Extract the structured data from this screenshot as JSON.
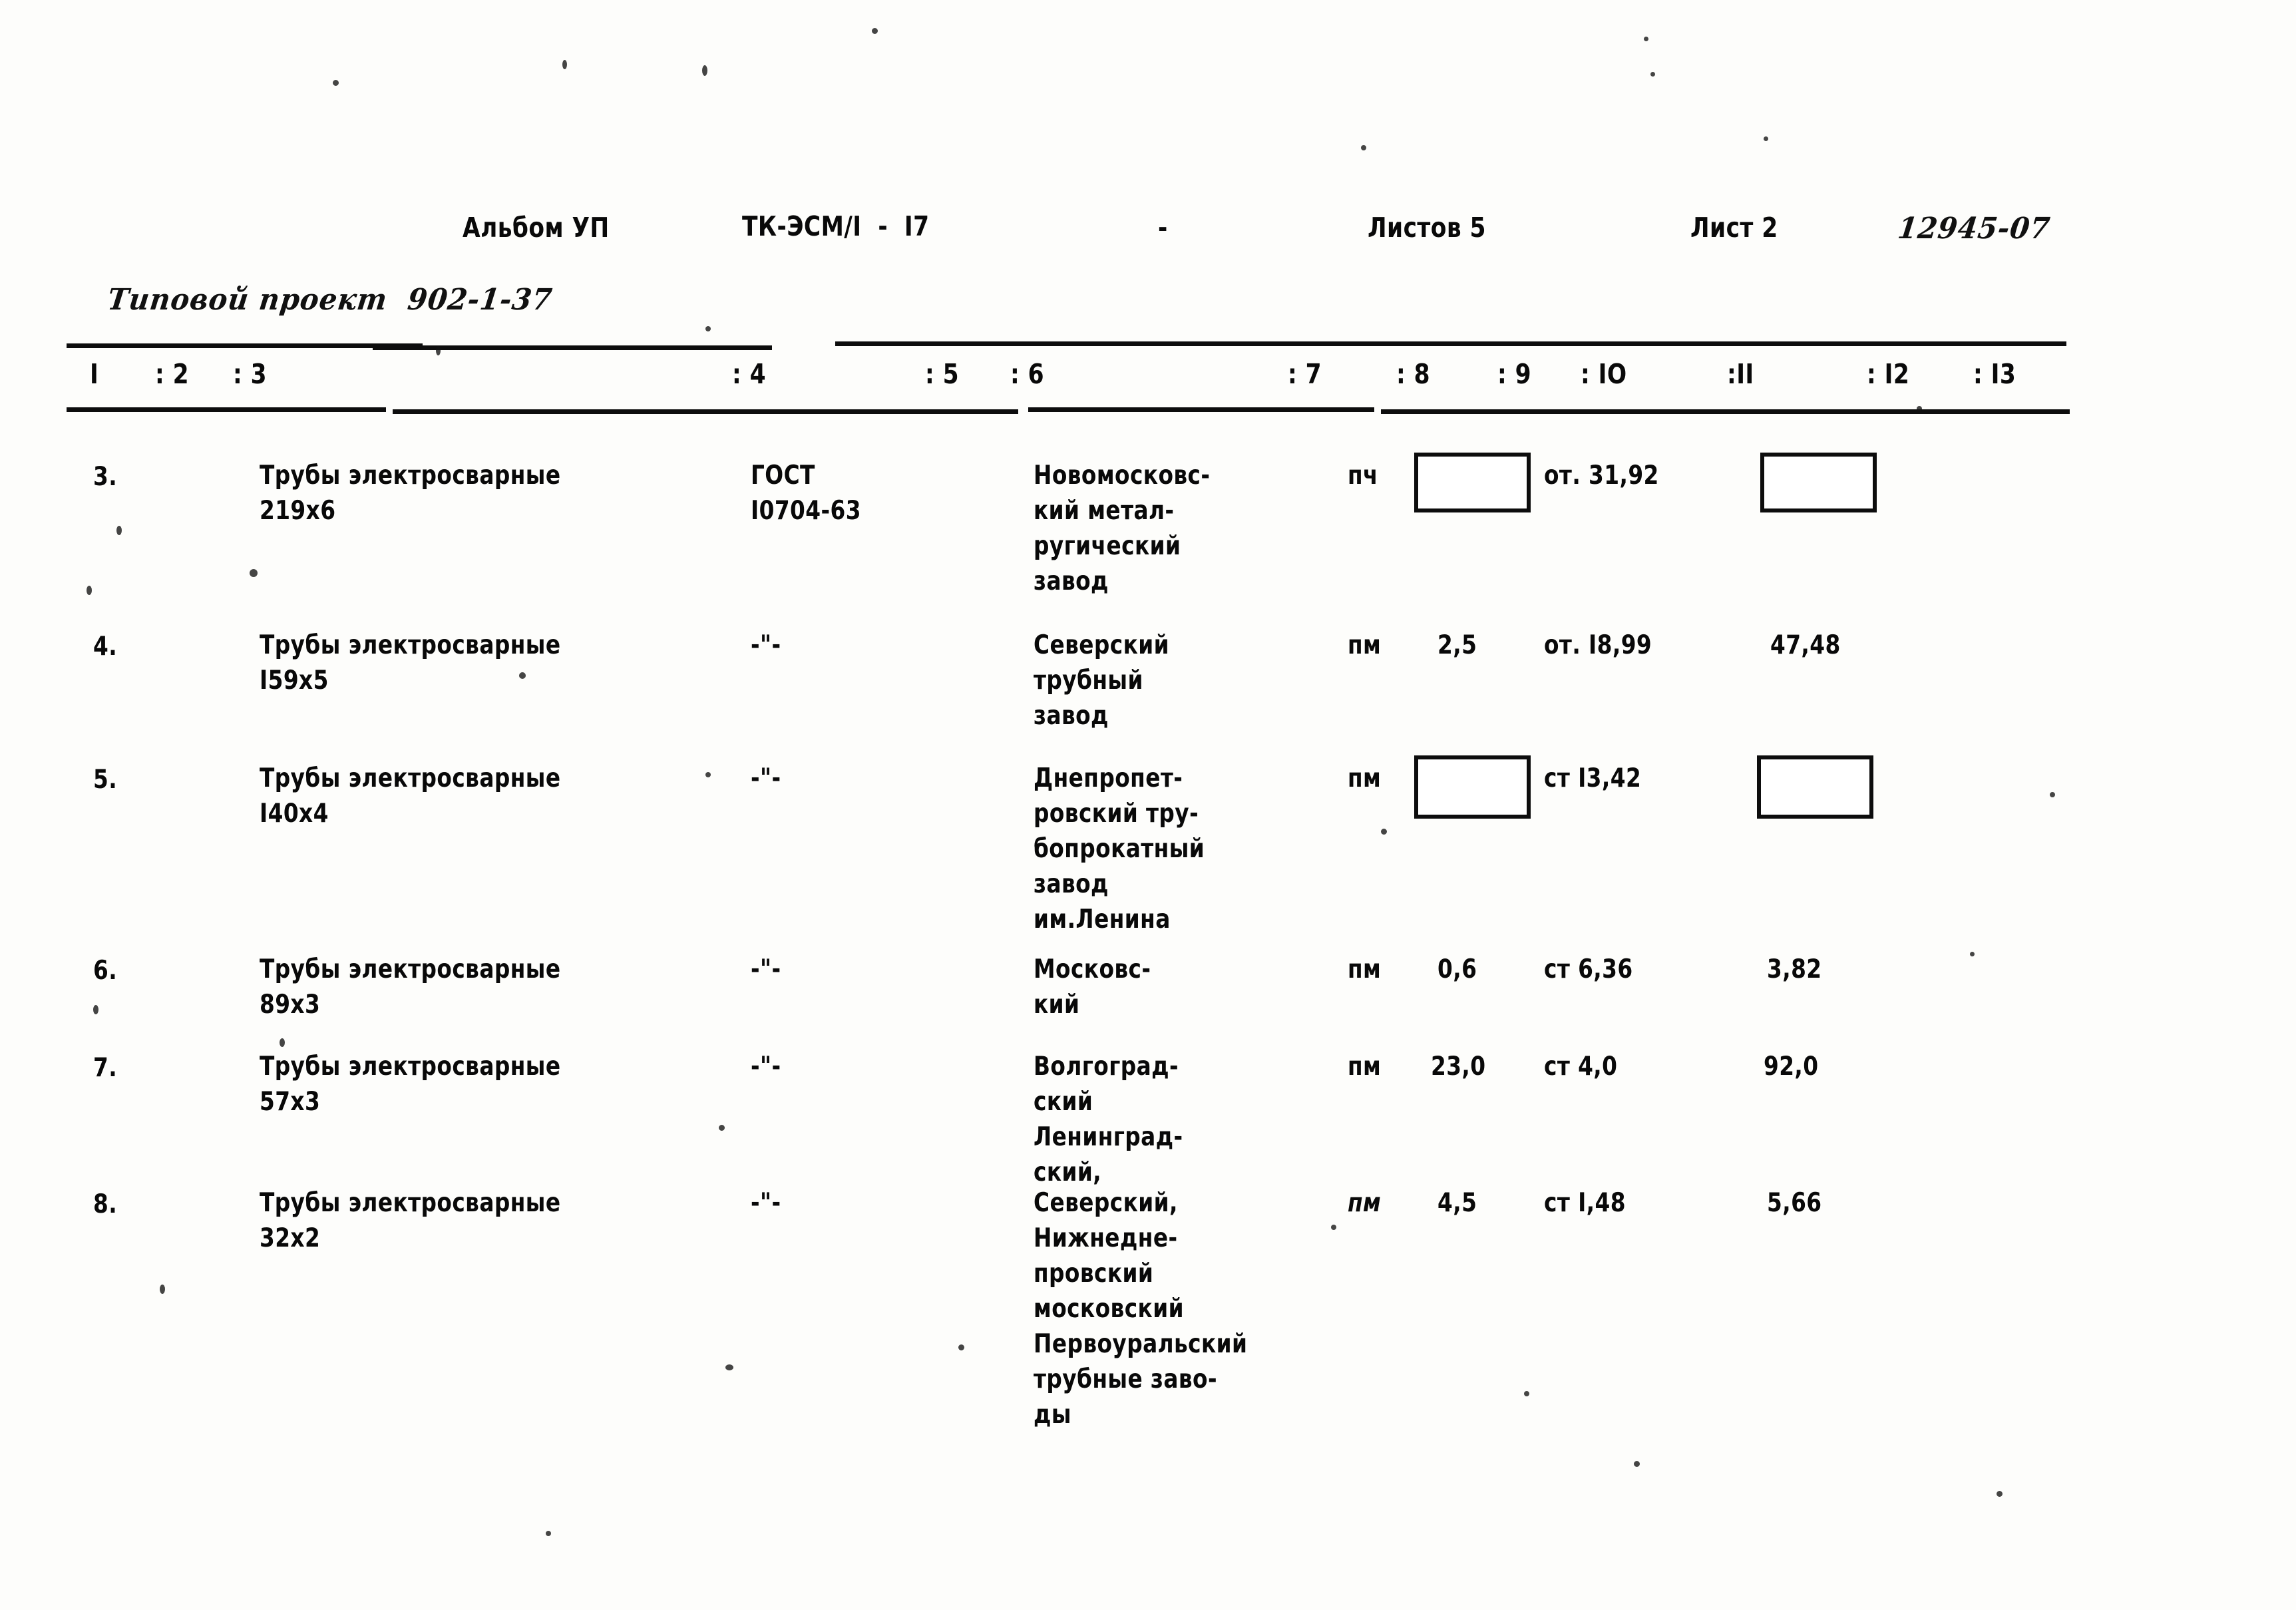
{
  "document": {
    "header": {
      "album_label": "Альбом УП",
      "code": "ТК-ЭСМ/I  -  I7",
      "dash": "-",
      "sheets_total": "Листов 5",
      "sheet_current": "Лист 2",
      "doc_number": "12945-07",
      "project_label": "Типовой проект  902-1-37"
    },
    "column_numbers": {
      "c1": "I",
      "c2": ": 2",
      "c3": ": 3",
      "c4": ": 4",
      "c5": ": 5",
      "c6": ": 6",
      "c7": ": 7",
      "c8": ": 8",
      "c9": ": 9",
      "c10": ": IO",
      "c11": ":II",
      "c12": ": I2",
      "c13": ": I3"
    },
    "rows": [
      {
        "no": "3.",
        "name_line1": "Трубы электросварные",
        "name_line2": "219х6",
        "standard_line1": "ГОСТ",
        "standard_line2": "I0704-63",
        "supplier_lines": [
          "Новомосковс-",
          "кий метал-",
          "ругический",
          "завод"
        ],
        "unit": "пч",
        "qty": "",
        "qty_blank": true,
        "material": "от. 31,92",
        "mass": "",
        "mass_blank": true
      },
      {
        "no": "4.",
        "name_line1": "Трубы электросварные",
        "name_line2": "I59х5",
        "standard_line1": "-\"-",
        "standard_line2": "",
        "supplier_lines": [
          "Северский",
          "трубный",
          "завод"
        ],
        "unit": "пм",
        "qty": "2,5",
        "qty_blank": false,
        "material": "от. I8,99",
        "mass": "47,48",
        "mass_blank": false
      },
      {
        "no": "5.",
        "name_line1": "Трубы электросварные",
        "name_line2": "I40х4",
        "standard_line1": "-\"-",
        "standard_line2": "",
        "supplier_lines": [
          "Днепропет-",
          "ровский тру-",
          "бопрокатный",
          "завод",
          "им.Ленина"
        ],
        "unit": "пм",
        "qty": "",
        "qty_blank": true,
        "material": "ст I3,42",
        "mass": "",
        "mass_blank": true
      },
      {
        "no": "6.",
        "name_line1": "Трубы электросварные",
        "name_line2": "89х3",
        "standard_line1": "-\"-",
        "standard_line2": "",
        "supplier_lines": [
          "Московс-",
          "кий"
        ],
        "unit": "пм",
        "qty": "0,6",
        "qty_blank": false,
        "material": "ст 6,36",
        "mass": "3,82",
        "mass_blank": false
      },
      {
        "no": "7.",
        "name_line1": "Трубы электросварные",
        "name_line2": "57х3",
        "standard_line1": "-\"-",
        "standard_line2": "",
        "supplier_lines": [
          "Волгоград-",
          "ский",
          "Ленинград-",
          "ский,"
        ],
        "unit": "пм",
        "qty": "23,0",
        "qty_blank": false,
        "material": "ст 4,0",
        "mass": "92,0",
        "mass_blank": false
      },
      {
        "no": "8.",
        "name_line1": "Трубы электросварные",
        "name_line2": "32х2",
        "standard_line1": "-\"-",
        "standard_line2": "",
        "supplier_lines": [
          "Северский,",
          "Нижнедне-",
          "провский",
          "московский",
          "Первоуральский",
          "трубные заво-",
          "ды"
        ],
        "unit": "пм",
        "qty": "4,5",
        "qty_blank": false,
        "material": "ст I,48",
        "mass": "5,66",
        "mass_blank": false
      }
    ]
  }
}
